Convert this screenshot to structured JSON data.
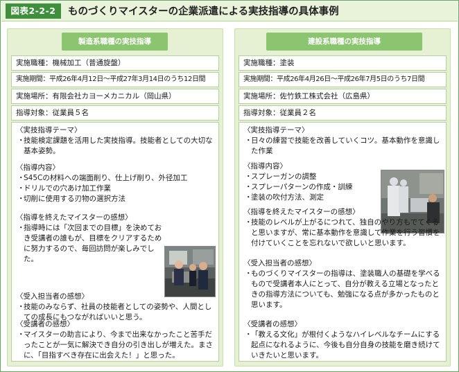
{
  "figure": {
    "number": "図表2-2-2",
    "title": "ものづくりマイスターの企業派遣による実技指導の具体事例"
  },
  "left": {
    "heading": "製造系職種の実技指導",
    "rows": [
      "実施職種：機械加工（普通旋盤）",
      "実施期間：平成26年4月12日〜平成27年3月14日のうち12日間",
      "実施場所：有限会社カヨーメカニカル（岡山県）",
      "指導対象：従業員５名"
    ],
    "theme": {
      "title": "〈実技指導テーマ〉",
      "items": [
        "技能検定課題を活用した実技指導。技能者としての大切な基本姿勢。"
      ]
    },
    "content": {
      "title": "〈指導内容〉",
      "items": [
        "S45Cの材料への端面削り、仕上げ削り、外径加工",
        "ドリルでの穴あけ加工作業",
        "切削に使用する刃物の選択方法"
      ]
    },
    "impression": {
      "title": "〈指導を終えたマイスターの感想〉",
      "items": [
        "指導時には「次回までの目標」を決めておき受講者の誰もが、目標をクリアするために努力するので、毎回訪問が楽しみでした。"
      ]
    },
    "manager": {
      "title": "〈受入担当者の感想〉",
      "items": [
        "技能のみならず、社員の技能者としての姿勢や、人間としての成長にもつながればいいと思う。"
      ]
    },
    "trainee": {
      "title": "〈受講者の感想〉",
      "items": [
        "マイスターの助言により、今まで出来なかったこと苦手だったことが一気に解決でき自分の引き出しが増えた。まさに、「目指すべき存在に出会えた！」と思った。"
      ]
    }
  },
  "right": {
    "heading": "建設系職種の実技指導",
    "rows": [
      "実施職種：塗装",
      "実施期間：平成26年4月26日〜平成26年7月5日のうち7日間",
      "実施場所：佐竹鉄工株式会社（広島県）",
      "指導対象：従業員２名"
    ],
    "theme": {
      "title": "〈実技指導テーマ〉",
      "items": [
        "日々の練習で技能を改善していくコツ。基本動作を意識した作業"
      ]
    },
    "content": {
      "title": "〈指導内容〉",
      "items": [
        "スプレーガンの調整",
        "スプレーパターンの作成・訓練",
        "塗装の吹付方法、測定"
      ]
    },
    "impression": {
      "title": "〈指導を終えたマイスターの感想〉",
      "items": [
        "技能のレベルが上がるにつれて、独自のやり方もでてくると思いますが、常に基本動作を意識して作業を行う習慣を付けていくことを忘れないで欲しいと思います。"
      ]
    },
    "manager": {
      "title": "〈受入担当者の感想〉",
      "items": [
        "ものづくりマイスターの指導は、塗装職人の基礎を学べるもので受講者本人にとって、自分が教える立場となったときの指導方法についても、勉強になる点が多かったものと思います。"
      ]
    },
    "trainee": {
      "title": "〈受講者の感想〉",
      "items": [
        "「教える文化」が根付くようなハイレベルなチームにする起点になれるように、今後も自分自身の技能を磨き続けていきたいと思います。"
      ]
    }
  },
  "bullet_char": "・"
}
